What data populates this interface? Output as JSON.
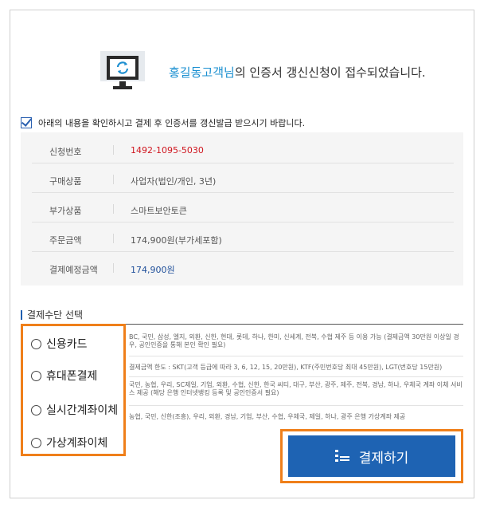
{
  "header": {
    "name": "홍길동고객님",
    "message": "의 인증서 갱신신청이 접수되었습니다."
  },
  "notice": "아래의 내용을 확인하시고 결제 후 인증서를 갱신발급 받으시기 바랍니다.",
  "order": {
    "rows": [
      {
        "label": "신청번호",
        "value": "1492-1095-5030"
      },
      {
        "label": "구매상품",
        "value": "사업자(법인/개인, 3년)"
      },
      {
        "label": "부가상품",
        "value": "스마트보안토큰"
      },
      {
        "label": "주문금액",
        "value": "174,900원(부가세포함)"
      },
      {
        "label": "결제예정금액",
        "value": "174,900원"
      }
    ]
  },
  "payment": {
    "title": "결제수단 선택",
    "methods": [
      {
        "label": "신용카드",
        "desc": "BC, 국민, 삼성, 엘지, 외환, 신한, 현대, 롯데, 하나, 한미, 신세계, 전북, 수협 제주 등 이용 가능 (결제금액 30만원 이상일 경우, 공인인증을 통해 본인 확인 필요)"
      },
      {
        "label": "휴대폰결제",
        "desc": "결제금액 한도 : SKT(고객 등급에 따라 3, 6, 12, 15, 20만원), KTF(주민번호당 최대 45만원), LGT(번호당 15만원)"
      },
      {
        "label": "실시간계좌이체",
        "desc": "국민, 농협, 우리, SC제일, 기업, 외환, 수협, 신한, 한국 씨티, 대구, 부산, 광주, 제주, 전북, 경남, 하나, 우체국 계좌 이체 서비스 제공 (해당 은행 인터넷뱅킹 등록 및 공인인증서 필요)"
      },
      {
        "label": "가상계좌이체",
        "desc": "농협, 국민, 신한(조흥), 우리, 외환, 경남, 기업, 부산, 수협, 우체국, 제일, 하나, 광주 은행 가상계좌 제공"
      }
    ],
    "pay_button": "결제하기"
  },
  "colors": {
    "accent": "#1e63b3",
    "highlight": "#ef7f1a",
    "order_no": "#d0161f"
  }
}
